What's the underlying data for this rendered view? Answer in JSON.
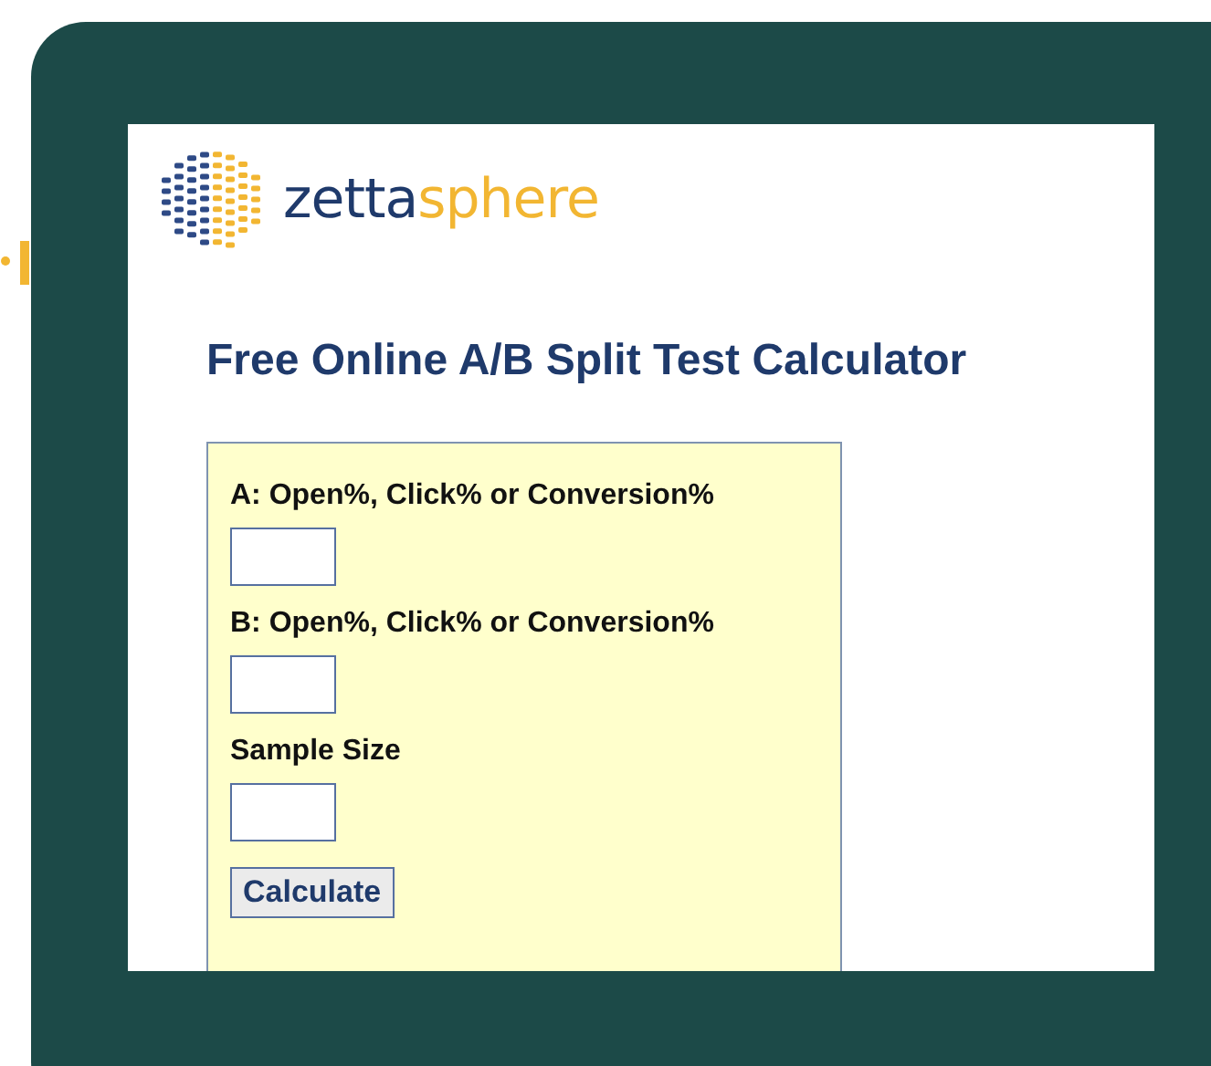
{
  "logo": {
    "part_dark": "zetta",
    "part_light": "sphere"
  },
  "heading": "Free Online A/B Split Test Calculator",
  "form": {
    "fields": [
      {
        "label": "A: Open%, Click% or Conversion%"
      },
      {
        "label": "B: Open%, Click% or Conversion%"
      },
      {
        "label": "Sample Size"
      }
    ],
    "button": "Calculate"
  }
}
